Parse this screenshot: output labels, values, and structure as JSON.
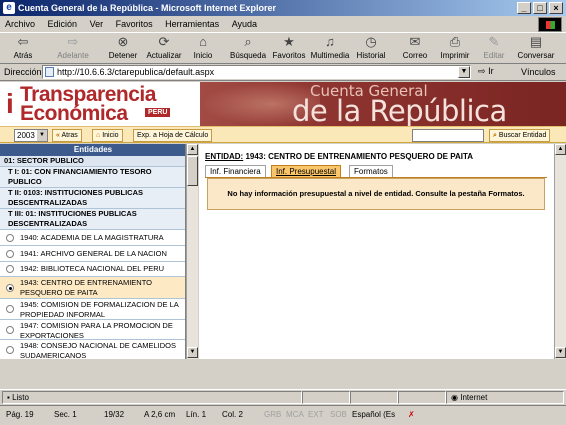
{
  "window": {
    "title": "Cuenta General de la República - Microsoft Internet Explorer"
  },
  "menu": [
    "Archivo",
    "Edición",
    "Ver",
    "Favoritos",
    "Herramientas",
    "Ayuda"
  ],
  "toolbar": {
    "back": "Atrás",
    "forward": "Adelante",
    "stop": "Detener",
    "refresh": "Actualizar",
    "home": "Inicio",
    "search": "Búsqueda",
    "favorites": "Favoritos",
    "media": "Multimedia",
    "history": "Historial",
    "mail": "Correo",
    "print": "Imprimir",
    "edit": "Editar",
    "discuss": "Conversar"
  },
  "address": {
    "label": "Dirección",
    "url": "http://10.6.6.3/ctarepublica/default.aspx",
    "go": "Ir",
    "links": "Vínculos"
  },
  "banner": {
    "logo_line1": "Transparencia",
    "logo_line2": "Económica",
    "logo_badge": "PERU",
    "title_small": "Cuenta General",
    "title_big": "de la República"
  },
  "searchbar": {
    "year": "2003",
    "back": "Atras",
    "home": "Inicio",
    "export": "Exp. a Hoja de Cálculo",
    "search_button": "Buscar Entidad",
    "search_value": ""
  },
  "entities": {
    "header": "Entidades",
    "sector": "01: SECTOR PUBLICO",
    "level1": "T I: 01: CON FINANCIAMIENTO TESORO PUBLICO",
    "level2": "T II: 0103: INSTITUCIONES PUBLICAS DESCENTRALIZADAS",
    "level3": "T III: 01: INSTITUCIONES PUBLICAS DESCENTRALIZADAS",
    "items": [
      {
        "label": "1940: ACADEMIA DE LA MAGISTRATURA"
      },
      {
        "label": "1941: ARCHIVO GENERAL DE LA NACION"
      },
      {
        "label": "1942: BIBLIOTECA NACIONAL DEL PERU"
      },
      {
        "label": "1943: CENTRO DE ENTRENAMIENTO PESQUERO DE PAITA"
      },
      {
        "label": "1945: COMISION DE FORMALIZACION DE LA PROPIEDAD INFORMAL"
      },
      {
        "label": "1947: COMISION PARA LA PROMOCION DE EXPORTACIONES"
      },
      {
        "label": "1948: CONSEJO NACIONAL DE CAMELIDOS SUDAMERICANOS"
      }
    ]
  },
  "detail": {
    "entity_prefix": "ENTIDAD:",
    "entity_name": "1943: CENTRO DE ENTRENAMIENTO PESQUERO DE PAITA",
    "tabs": [
      "Inf. Financiera",
      "Inf. Presupuestal",
      "Formatos"
    ],
    "active_tab": "Inf. Presupuestal",
    "message": "No hay información presupuestal a nivel de entidad. Consulte la pestaña Formatos."
  },
  "statusbar": {
    "status": "Listo",
    "zone": "Internet"
  },
  "word_status": {
    "page": "Pág. 19",
    "section": "Sec. 1",
    "pages": "19/32",
    "at": "A 2,6 cm",
    "line": "Lín. 1",
    "col": "Col. 2",
    "grb": "GRB",
    "mca": "MCA",
    "ext": "EXT",
    "sob": "SOB",
    "lang": "Español (Es"
  },
  "colors": {
    "title_start": "#0a246a",
    "accent_red": "#b0282a",
    "tab_active": "#fbc56a",
    "panel_header": "#3c5a8c"
  }
}
